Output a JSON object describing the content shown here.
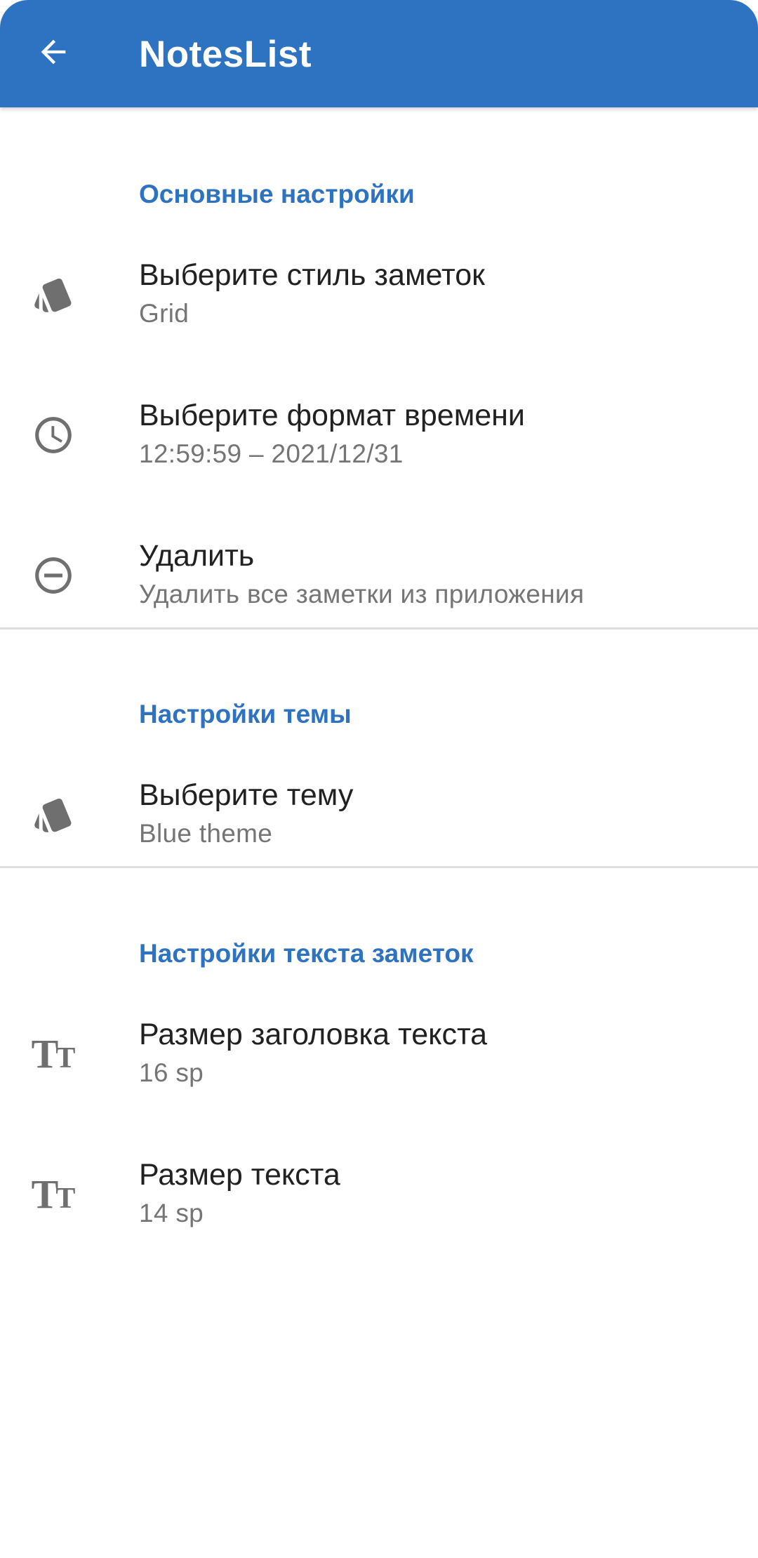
{
  "app_bar": {
    "title": "NotesList",
    "back_icon": "arrow-back-icon",
    "color": "#2e73c1"
  },
  "sections": {
    "main": {
      "header": "Основные настройки",
      "items": [
        {
          "title": "Выберите стиль заметок",
          "summary": "Grid",
          "icon": "style-icon"
        },
        {
          "title": "Выберите формат времени",
          "summary": "12:59:59 – 2021/12/31",
          "icon": "clock-icon"
        },
        {
          "title": "Удалить",
          "summary": "Удалить все заметки из приложения",
          "icon": "remove-circle-icon"
        }
      ]
    },
    "theme": {
      "header": "Настройки темы",
      "items": [
        {
          "title": "Выберите тему",
          "summary": "Blue theme",
          "icon": "style-icon"
        }
      ]
    },
    "text": {
      "header": "Настройки текста заметок",
      "items": [
        {
          "title": "Размер заголовка текста",
          "summary": "16 sp",
          "icon": "text-size-icon"
        },
        {
          "title": "Размер текста",
          "summary": "14 sp",
          "icon": "text-size-icon"
        }
      ]
    }
  },
  "colors": {
    "accent": "#2e73c1",
    "title_text": "#212121",
    "summary_text": "#757575",
    "icon": "#6f6f6f",
    "divider": "#dedede"
  }
}
